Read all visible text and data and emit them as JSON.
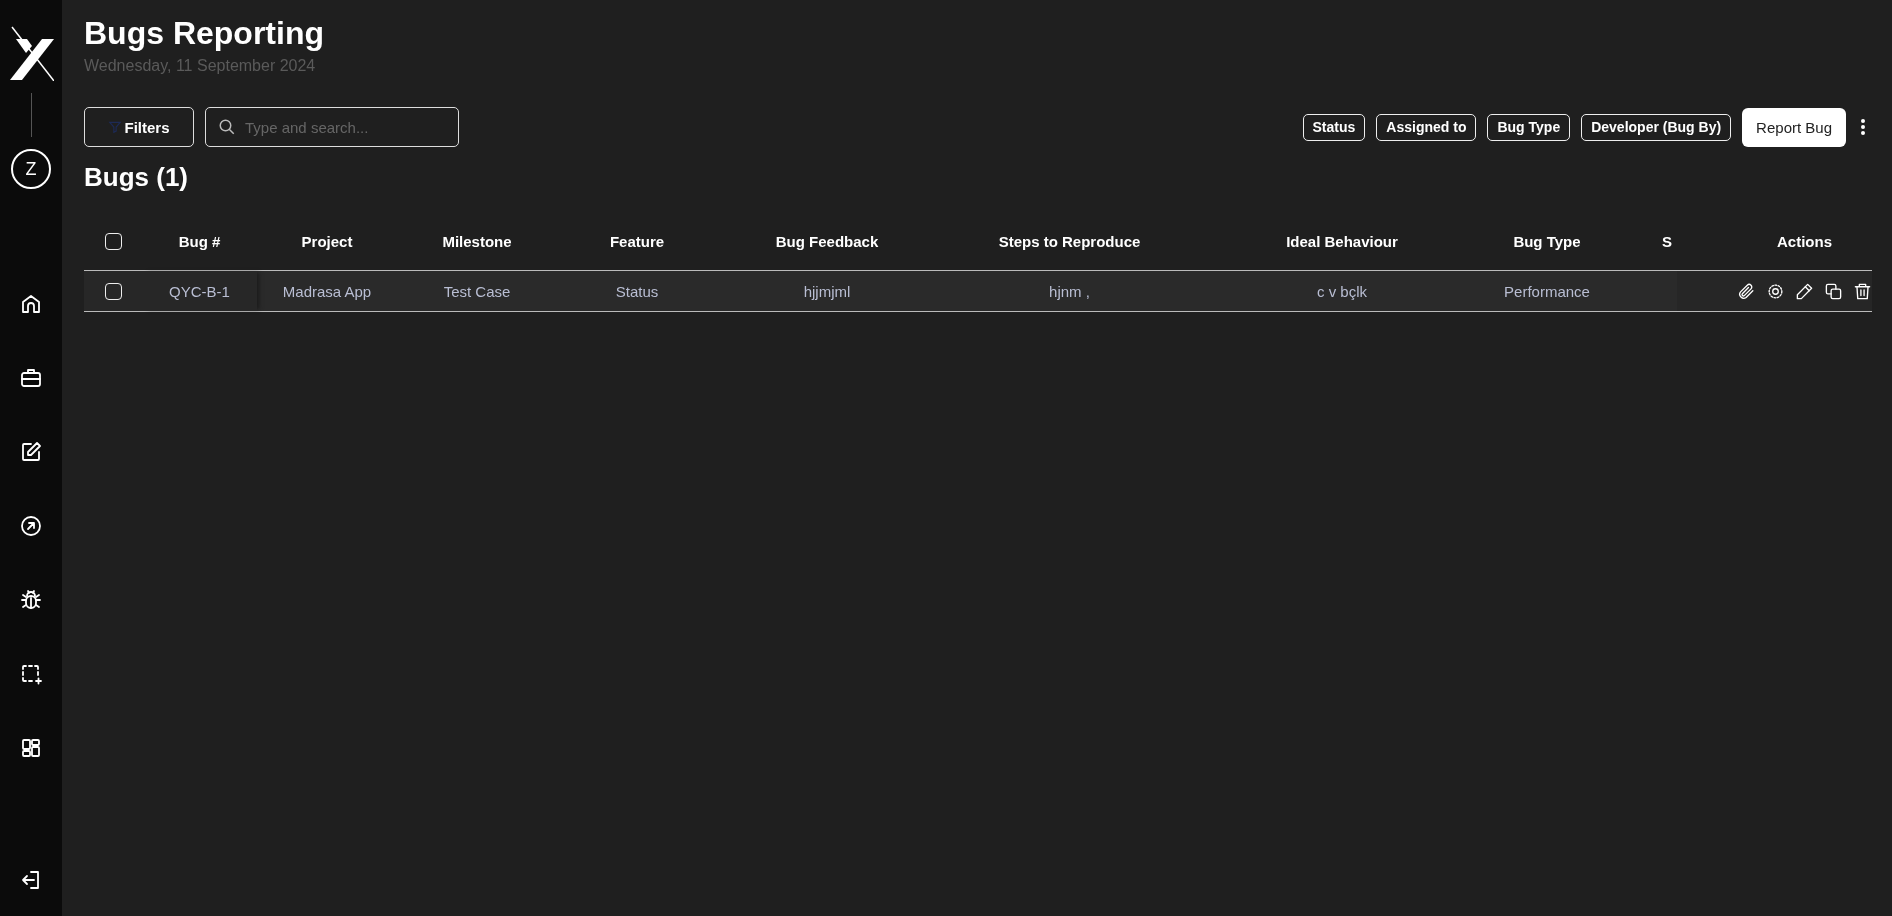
{
  "sidebar": {
    "avatar": "Z"
  },
  "header": {
    "title": "Bugs Reporting",
    "date": "Wednesday, 11 September 2024"
  },
  "toolbar": {
    "filters": "Filters",
    "search": {
      "placeholder": "Type and search..."
    },
    "chips": [
      "Status",
      "Assigned to",
      "Bug Type",
      "Developer (Bug By)"
    ],
    "primary": "Report Bug"
  },
  "section": {
    "title": "Bugs (1)"
  },
  "table": {
    "select_all": {
      "checked": false
    },
    "columns": [
      "Bug #",
      "Project",
      "Milestone",
      "Feature",
      "Bug Feedback",
      "Steps to Reproduce",
      "Ideal Behaviour",
      "Bug Type",
      "S",
      "Actions"
    ],
    "rows": [
      {
        "checked": false,
        "cells": [
          "QYC-B-1",
          "Madrasa App",
          "Test Case",
          "Status",
          "hjjmjml",
          "hjnm ,",
          "c v bçlk",
          "Performance",
          ""
        ]
      }
    ]
  }
}
